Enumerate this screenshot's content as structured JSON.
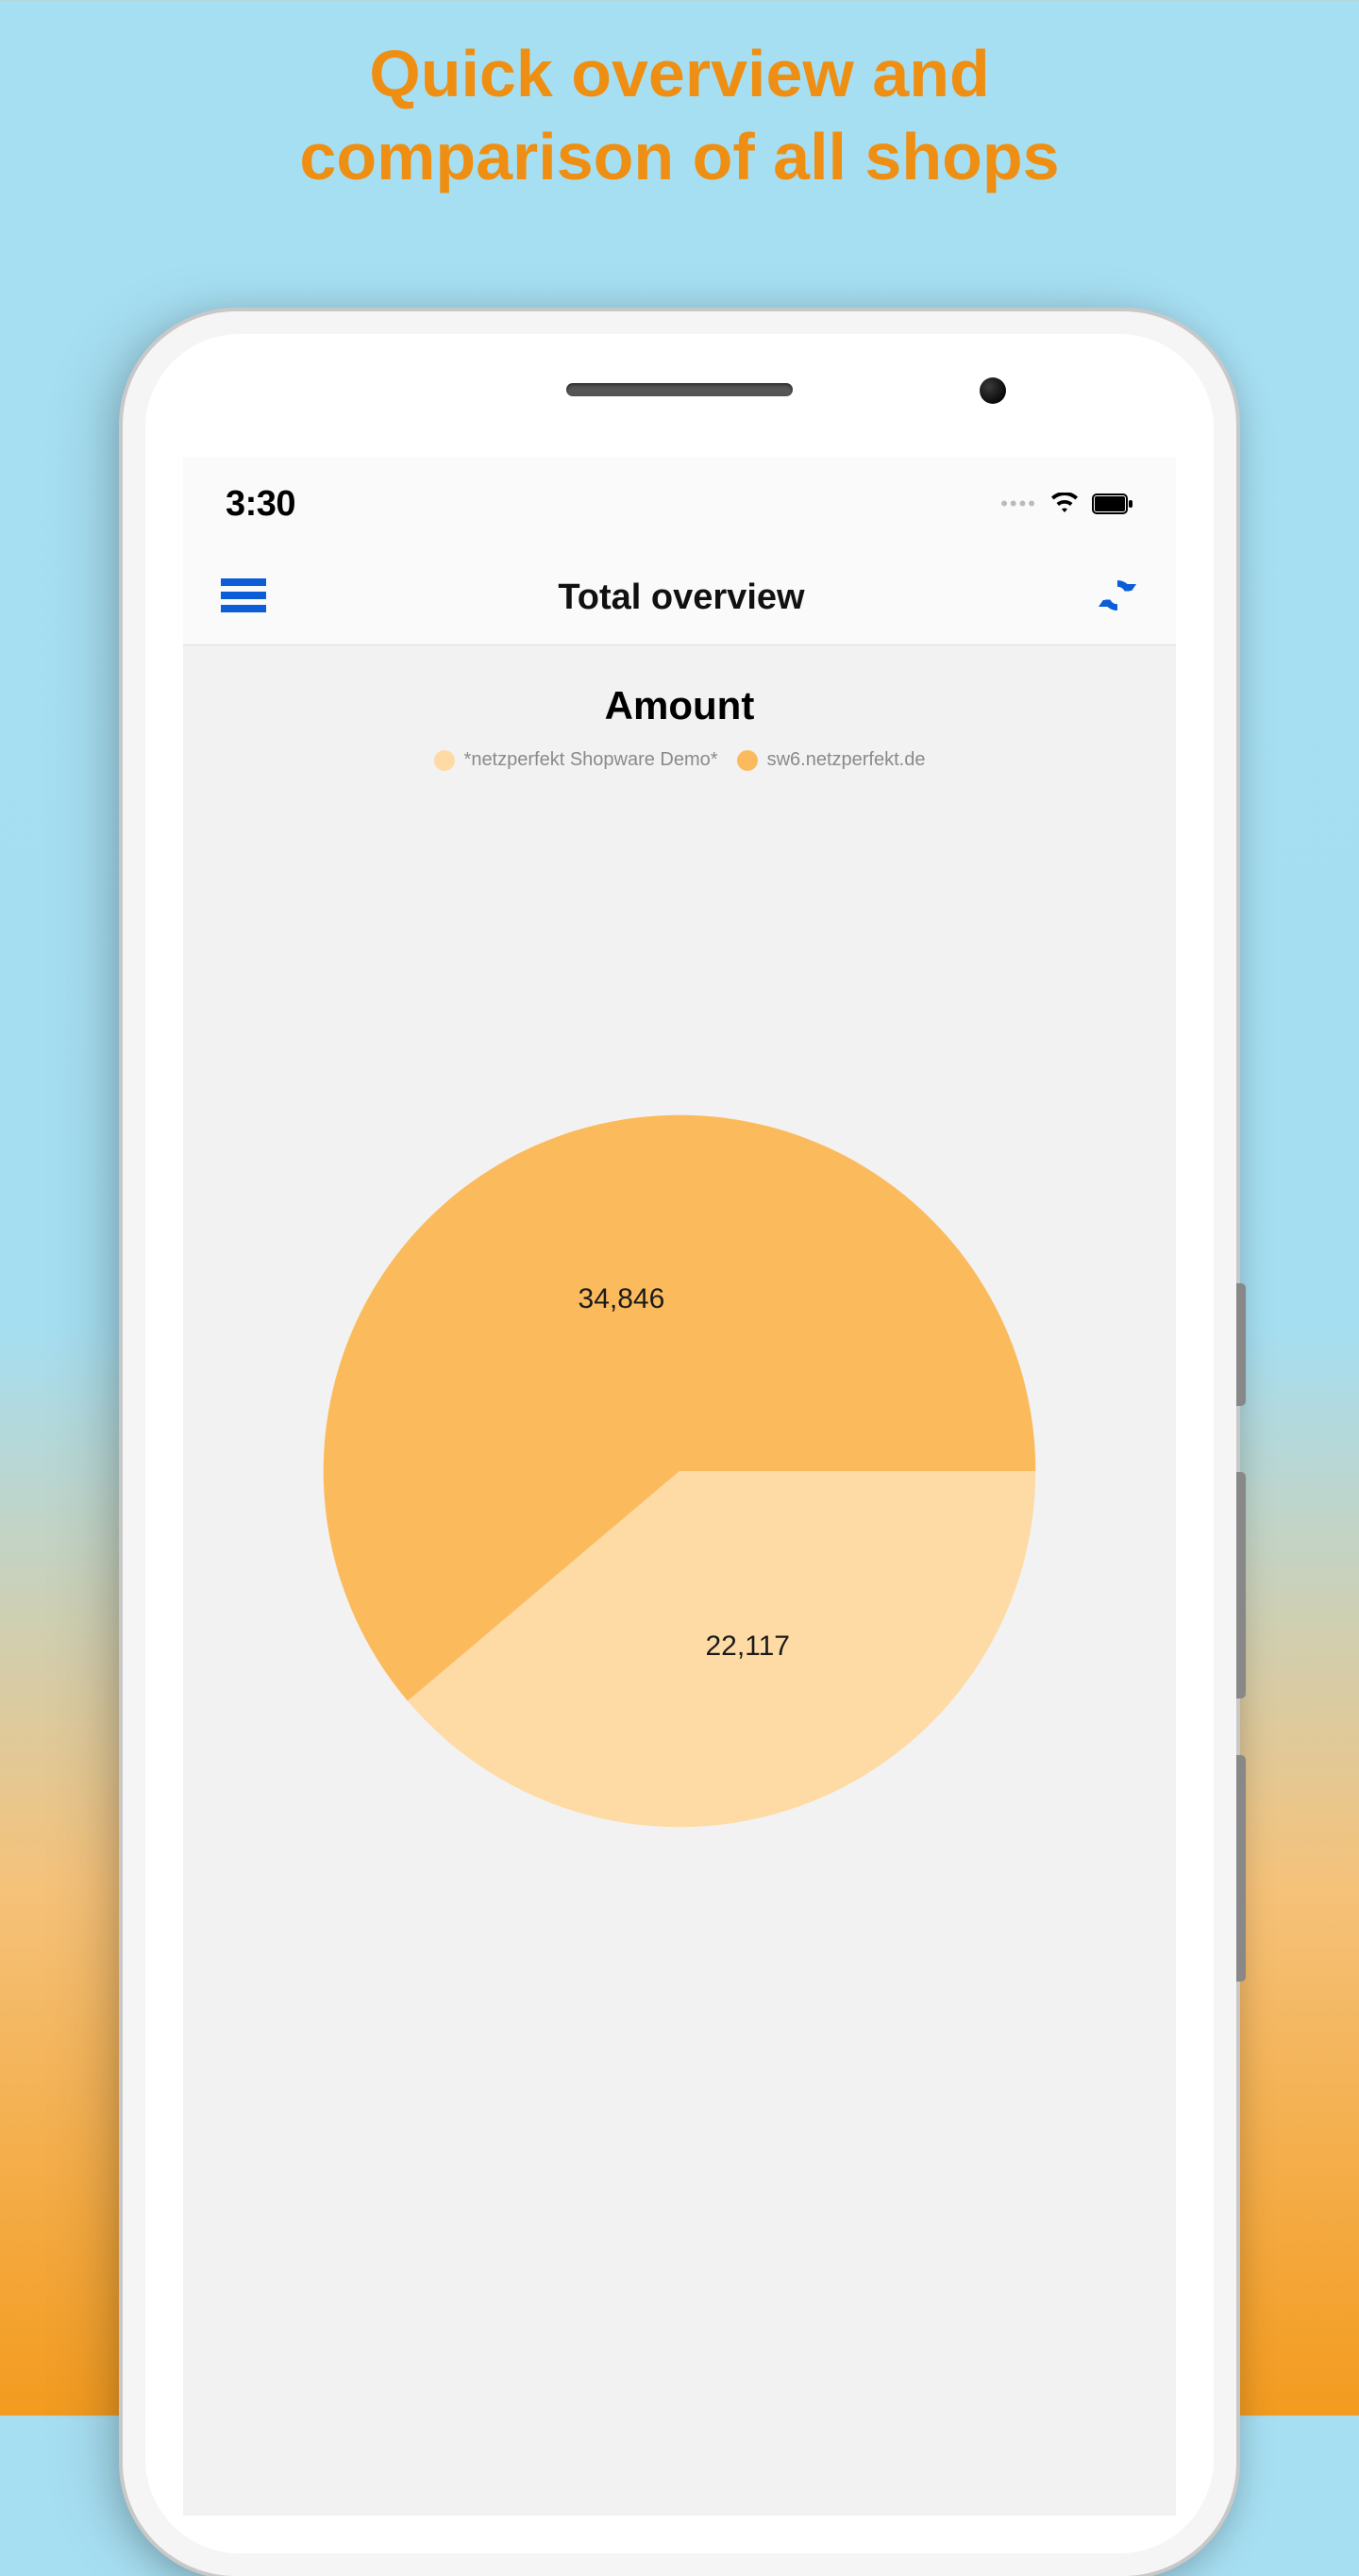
{
  "promo": {
    "line1": "Quick overview and",
    "line2": "comparison of all shops"
  },
  "status_bar": {
    "time": "3:30"
  },
  "nav": {
    "title": "Total overview"
  },
  "chart_data": {
    "type": "pie",
    "title": "Amount",
    "series": [
      {
        "name": "*netzperfekt Shopware Demo*",
        "value": 22117,
        "label": "22,117",
        "color": "#fedba5"
      },
      {
        "name": "sw6.netzperfekt.de",
        "value": 34846,
        "label": "34,846",
        "color": "#fbbb5d"
      }
    ]
  }
}
